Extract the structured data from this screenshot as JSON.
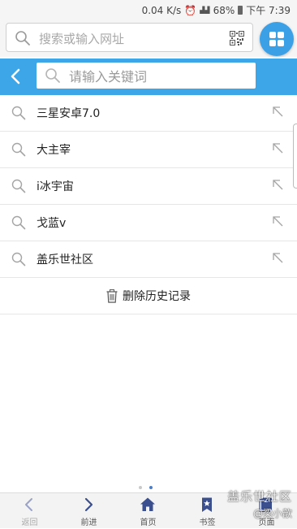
{
  "status_bar": {
    "speed": "0.04 K/s",
    "battery": "68%",
    "time": "下午 7:39"
  },
  "browser_bar": {
    "url_placeholder": "搜索或输入网址"
  },
  "search_header": {
    "keyword_placeholder": "请输入关键词"
  },
  "history": {
    "items": [
      {
        "label": "三星安卓7.0"
      },
      {
        "label": "大主宰"
      },
      {
        "label": "i冰宇宙"
      },
      {
        "label": "戈蓝v"
      },
      {
        "label": "盖乐世社区"
      }
    ],
    "clear_label": "删除历史记录"
  },
  "bottom_nav": {
    "items": [
      {
        "label": "返回",
        "icon": "chevron-left-icon"
      },
      {
        "label": "前进",
        "icon": "chevron-right-icon"
      },
      {
        "label": "首页",
        "icon": "home-icon"
      },
      {
        "label": "书签",
        "icon": "bookmark-icon"
      },
      {
        "label": "页面",
        "icon": "tabs-icon"
      }
    ],
    "tab_count": "2"
  },
  "watermark": {
    "site": "盖乐世社区",
    "user": "@梁小歆"
  },
  "colors": {
    "accent": "#3ca6e8",
    "grid_button": "#3ca0e6",
    "nav_icon": "#3b4f8f"
  }
}
